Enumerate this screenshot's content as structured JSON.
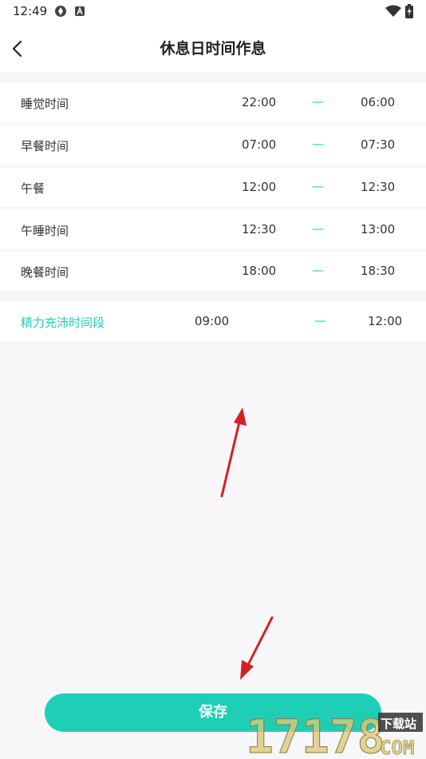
{
  "status_bar": {
    "time": "12:49"
  },
  "header": {
    "title": "休息日时间作息"
  },
  "schedule": [
    {
      "label": "睡觉时间",
      "start": "22:00",
      "dash": "—",
      "end": "06:00"
    },
    {
      "label": "早餐时间",
      "start": "07:00",
      "dash": "—",
      "end": "07:30"
    },
    {
      "label": "午餐",
      "start": "12:00",
      "dash": "—",
      "end": "12:30"
    },
    {
      "label": "午睡时间",
      "start": "12:30",
      "dash": "—",
      "end": "13:00"
    },
    {
      "label": "晚餐时间",
      "start": "18:00",
      "dash": "—",
      "end": "18:30"
    }
  ],
  "energy": {
    "label": "精力充沛时间段",
    "start": "09:00",
    "dash": "—",
    "end": "12:00"
  },
  "save_button": {
    "label": "保存"
  },
  "watermark": {
    "number": "17178",
    "site": "下载站",
    "suffix": "COM"
  },
  "colors": {
    "accent": "#1ecfb5",
    "annotation_arrow": "#d62020",
    "background": "#f7f7f9"
  },
  "icons": {
    "back": "chevron-left-icon",
    "wifi": "wifi-icon",
    "battery": "battery-charging-icon"
  }
}
